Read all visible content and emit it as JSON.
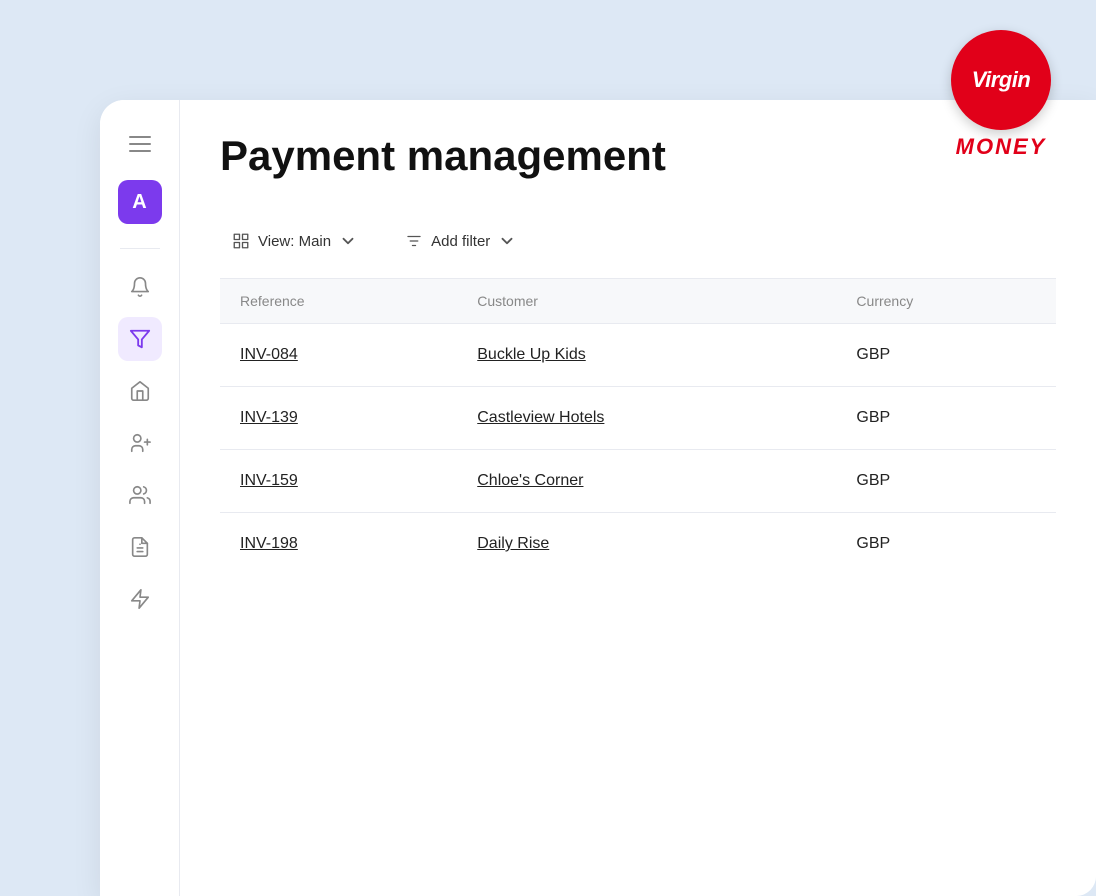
{
  "brand": {
    "name": "Virgin",
    "subtitle": "MONEY",
    "logo_text": "Virgin",
    "logo_subtitle": "mONEY"
  },
  "sidebar": {
    "avatar_letter": "A",
    "menu_items": [
      {
        "id": "notifications",
        "icon": "bell",
        "active": false
      },
      {
        "id": "filter",
        "icon": "filter",
        "active": true
      },
      {
        "id": "home",
        "icon": "home",
        "active": false
      },
      {
        "id": "contacts",
        "icon": "contacts",
        "active": false
      },
      {
        "id": "team",
        "icon": "team",
        "active": false
      },
      {
        "id": "documents",
        "icon": "documents",
        "active": false
      },
      {
        "id": "lightning",
        "icon": "lightning",
        "active": false
      }
    ]
  },
  "page": {
    "title": "Payment management"
  },
  "toolbar": {
    "view_label": "View: Main",
    "filter_label": "Add filter"
  },
  "table": {
    "columns": [
      "Reference",
      "Customer",
      "Currency"
    ],
    "rows": [
      {
        "reference": "INV-084",
        "customer": "Buckle Up Kids",
        "currency": "GBP"
      },
      {
        "reference": "INV-139",
        "customer": "Castleview Hotels",
        "currency": "GBP"
      },
      {
        "reference": "INV-159",
        "customer": "Chloe's Corner",
        "currency": "GBP"
      },
      {
        "reference": "INV-198",
        "customer": "Daily Rise",
        "currency": "GBP"
      }
    ]
  }
}
